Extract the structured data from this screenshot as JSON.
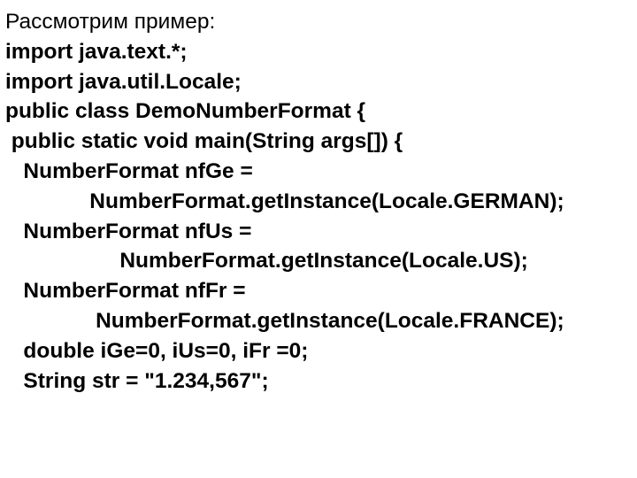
{
  "intro": "Рассмотрим пример:",
  "code": {
    "l1": "import java.text.*;",
    "l2": "import java.util.Locale;",
    "l3": "public class DemoNumberFormat {",
    "l4": " public static void main(String args[]) {",
    "l5": "   NumberFormat nfGe =",
    "l6": "              NumberFormat.getInstance(Locale.GERMAN);",
    "l7": "   NumberFormat nfUs =",
    "l8": "                   NumberFormat.getInstance(Locale.US);",
    "l9": "   NumberFormat nfFr =",
    "l10": "               NumberFormat.getInstance(Locale.FRANCE);",
    "l11": "   double iGe=0, iUs=0, iFr =0;",
    "l12": "   String str = \"1.234,567\";"
  }
}
